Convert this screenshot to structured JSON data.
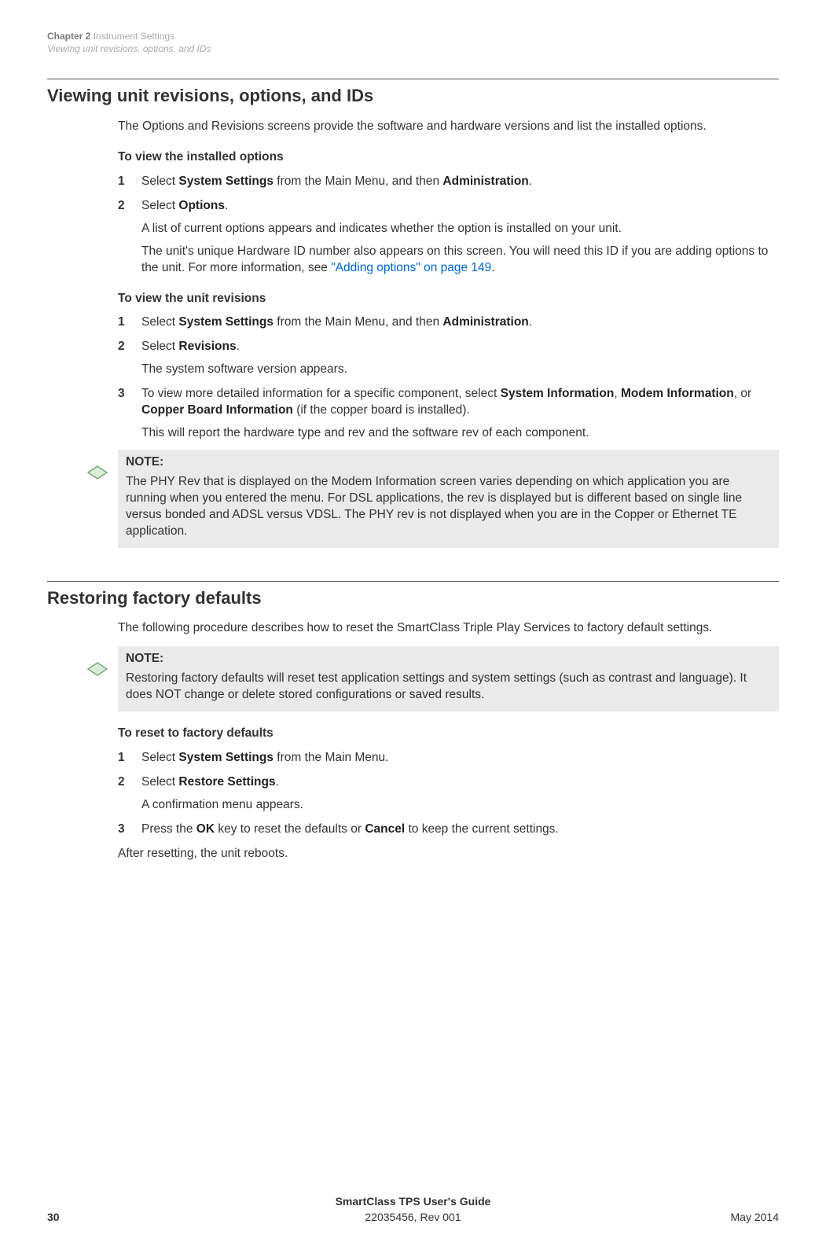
{
  "runningHead": {
    "chapterLabel": "Chapter 2",
    "chapterName": "Instrument Settings",
    "sectionName": "Viewing unit revisions, options, and IDs"
  },
  "section1": {
    "title": "Viewing unit revisions, options, and IDs",
    "intro": "The Options and Revisions screens provide the software and hardware versions and list the installed options.",
    "proc1Title": "To view the installed options",
    "step1a_pre": "Select ",
    "step1a_b1": "System Settings",
    "step1a_mid": " from the Main Menu, and then ",
    "step1a_b2": "Administration",
    "step1a_post": ".",
    "step2a_pre": "Select ",
    "step2a_b1": "Options",
    "step2a_post": ".",
    "step2a_p2": "A list of current options appears and indicates whether the option is installed on your unit.",
    "step2a_p3_pre": "The unit's unique Hardware ID number also appears on this screen. You will need this ID if you are adding options to the unit. For more information, see ",
    "step2a_p3_link": "\"Adding options\" on page 149",
    "step2a_p3_post": ".",
    "proc2Title": "To view the unit revisions",
    "step1b_pre": "Select ",
    "step1b_b1": "System Settings",
    "step1b_mid": " from the Main Menu, and then ",
    "step1b_b2": "Administration",
    "step1b_post": ".",
    "step2b_pre": "Select ",
    "step2b_b1": "Revisions",
    "step2b_post": ".",
    "step2b_p2": "The system software version appears.",
    "step3b_pre": "To view more detailed information for a specific component, select ",
    "step3b_b1": "System Information",
    "step3b_mid1": ", ",
    "step3b_b2": "Modem Information",
    "step3b_mid2": ", or ",
    "step3b_b3": "Copper Board Information",
    "step3b_post": " (if the copper board is installed).",
    "step3b_p2": "This will report the hardware type and rev and the software rev of each component.",
    "note1_label": "NOTE:",
    "note1_text": "The PHY Rev that is displayed on the Modem Information screen varies depending on which application you are running when you entered the menu. For DSL applications, the rev is displayed but is different based on single line versus bonded and ADSL versus VDSL. The PHY rev is not displayed when you are in the Copper or Ethernet TE application."
  },
  "section2": {
    "title": "Restoring factory defaults",
    "intro": "The following procedure describes how to reset the SmartClass Triple Play Services to factory default settings.",
    "note2_label": "NOTE:",
    "note2_text": "Restoring factory defaults will reset test application settings and system settings (such as contrast and language). It does NOT change or delete stored configurations or saved results.",
    "proc3Title": "To reset to factory defaults",
    "step1c_pre": "Select ",
    "step1c_b1": "System Settings",
    "step1c_post": " from the Main Menu.",
    "step2c_pre": "Select ",
    "step2c_b1": "Restore Settings",
    "step2c_post": ".",
    "step2c_p2": "A confirmation menu appears.",
    "step3c_pre": "Press the ",
    "step3c_b1": "OK",
    "step3c_mid": " key to reset the defaults or ",
    "step3c_b2": "Cancel",
    "step3c_post": " to keep the current settings.",
    "outro": "After resetting, the unit reboots."
  },
  "footer": {
    "guideTitle": "SmartClass TPS User's Guide",
    "docRev": "22035456, Rev 001",
    "pageNum": "30",
    "date": "May 2014"
  },
  "nums": {
    "n1": "1",
    "n2": "2",
    "n3": "3"
  }
}
